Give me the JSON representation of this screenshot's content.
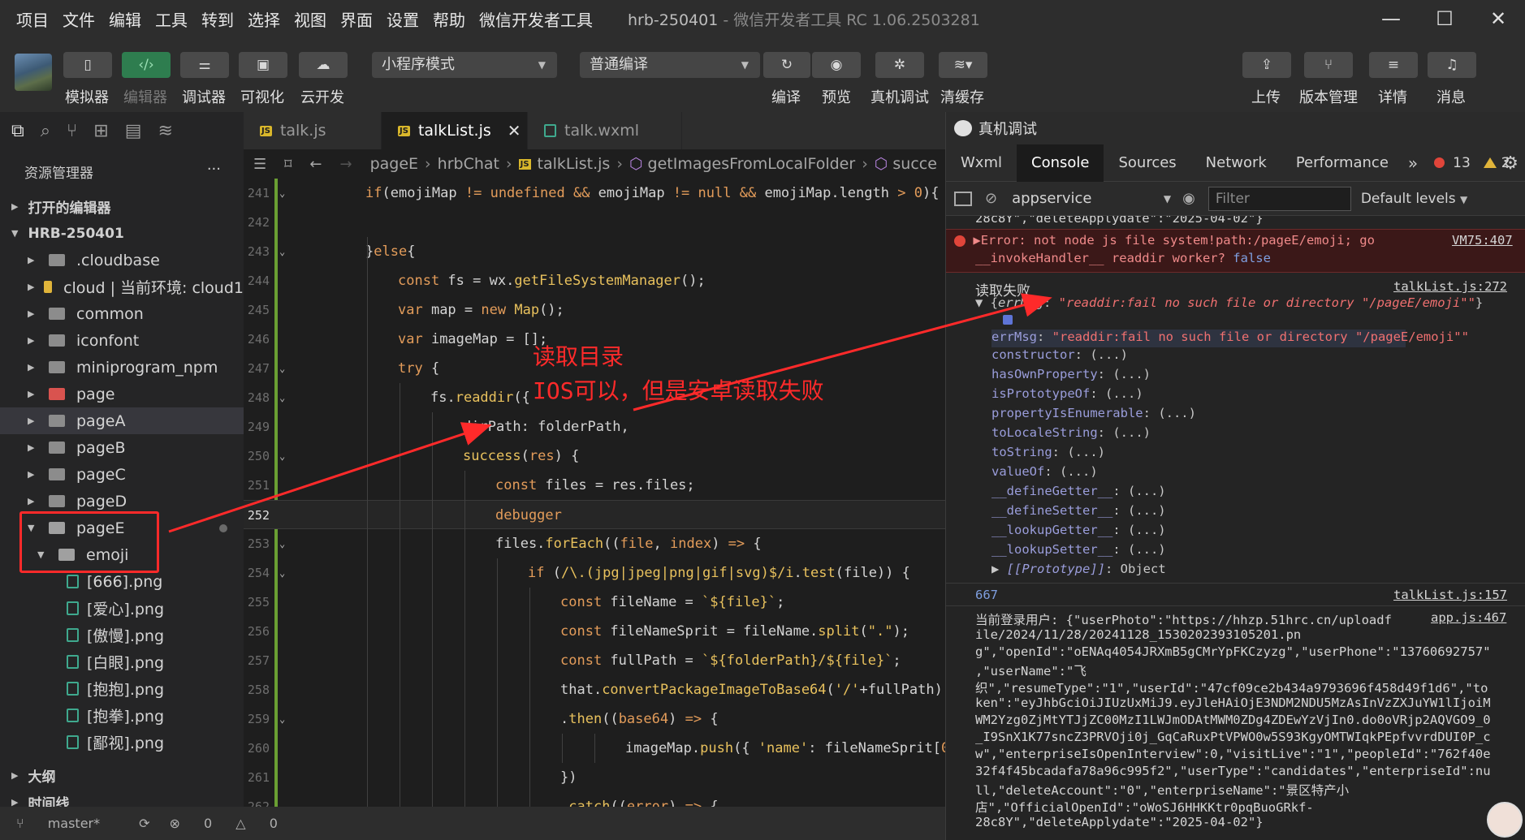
{
  "menu": [
    "项目",
    "文件",
    "编辑",
    "工具",
    "转到",
    "选择",
    "视图",
    "界面",
    "设置",
    "帮助",
    "微信开发者工具"
  ],
  "window": {
    "project": "hrb-250401",
    "title_suffix": "- 微信开发者工具 RC 1.06.2503281",
    "minimize": "—",
    "maximize": "☐",
    "close": "✕"
  },
  "toolbar": {
    "simulator": "模拟器",
    "editor": "编辑器",
    "debugger": "调试器",
    "visual": "可视化",
    "cloud": "云开发",
    "mode": "小程序模式",
    "compile": "普通编译",
    "recompile": "编译",
    "preview": "预览",
    "remote_debug": "真机调试",
    "clear_cache": "清缓存",
    "upload": "上传",
    "version": "版本管理",
    "details": "详情",
    "messages": "消息"
  },
  "explorer": {
    "title": "资源管理器",
    "more": "···",
    "open_editors": "打开的编辑器",
    "project": "HRB-250401",
    "items": [
      ".cloudbase",
      "cloud | 当前环境: cloud1",
      "common",
      "iconfont",
      "miniprogram_npm",
      "page",
      "pageA",
      "pageB",
      "pageC",
      "pageD",
      "pageE",
      "emoji"
    ],
    "files": [
      "[666].png",
      "[爱心].png",
      "[傲慢].png",
      "[白眼].png",
      "[抱抱].png",
      "[抱拳].png",
      "[鄙视].png"
    ],
    "outline": "大纲",
    "timeline": "时间线"
  },
  "status": {
    "branch": "master*",
    "errors": "0",
    "warnings": "0"
  },
  "tabs": [
    {
      "label": "talk.js"
    },
    {
      "label": "talkList.js"
    },
    {
      "label": "talk.wxml"
    }
  ],
  "breadcrumb": [
    "pageE",
    "hrbChat",
    "talkList.js",
    "getImagesFromLocalFolder",
    "succe"
  ],
  "code": {
    "lines": [
      "241",
      "242",
      "243",
      "244",
      "245",
      "246",
      "247",
      "248",
      "249",
      "250",
      "251",
      "252",
      "253",
      "254",
      "255",
      "256",
      "257",
      "258",
      "259",
      "260",
      "261",
      "262"
    ]
  },
  "annotation": {
    "line1": "读取目录",
    "line2": "IOS可以，但是安卓读取失败"
  },
  "devtools": {
    "title": "真机调试",
    "tabs": [
      "Wxml",
      "Console",
      "Sources",
      "Network",
      "Performance"
    ],
    "error_count": "13",
    "warning_count": "2",
    "context": "appservice",
    "filter_placeholder": "Filter",
    "levels": "Default levels",
    "top_partial": "28c8Y\",\"deleteApplydate\":\"2025-04-02\"}",
    "error_line1": "Error: not node js file system!path:/pageE/emoji; go",
    "error_link": "VM75:407",
    "error_line2": "__invokeHandler__ readdir worker?",
    "error_false": "false",
    "fail_label": "读取失败",
    "fail_link": "talkList.js:272",
    "errmsg_key": "errMsg",
    "errmsg_val": "\"readdir:fail no such file or directory \"/pageE/emoji\"\"",
    "props": [
      "constructor",
      "hasOwnProperty",
      "isPrototypeOf",
      "propertyIsEnumerable",
      "toLocaleString",
      "toString",
      "valueOf",
      "__defineGetter__",
      "__defineSetter__",
      "__lookupGetter__",
      "__lookupSetter__"
    ],
    "prop_value": "(...)",
    "prototype_key": "[[Prototype]]",
    "prototype_val": "Object",
    "count_val": "667",
    "count_link": "talkList.js:157",
    "user_link": "app.js:467",
    "user_lines": [
      "当前登录用户: {\"userPhoto\":\"https://hhzp.51hrc.cn/uploadf",
      "ile/2024/11/28/20241128_1530202393105201.pn",
      "g\",\"openId\":\"oENAq4054JRXmB5gCMrYpFKCzyzg\",\"userPhone\":\"13760692757\"",
      ",\"userName\":\"飞",
      "织\",\"resumeType\":\"1\",\"userId\":\"47cf09ce2b434a9793696f458d49f1d6\",\"to",
      "ken\":\"eyJhbGciOiJIUzUxMiJ9.eyJleHAiOjE3NDM2NDU5MzAsInVzZXJuYW1lIjoiM",
      "WM2Yzg0ZjMtYTJjZC00MzI1LWJmODAtMWM0ZDg4ZDEwYzVjIn0.do0oVRjp2AQVGO9_0",
      "_I9SnX1K77sncZ3PRVOji0j_GqCaRuxPtVPWO0w5S93KgyOMTWIqkPEpfvvrdDUI0P_c",
      "w\",\"enterpriseIsOpenInterview\":0,\"visitLive\":\"1\",\"peopleId\":\"762f40e",
      "32f4f45bcadafa78a96c995f2\",\"userType\":\"candidates\",\"enterpriseId\":nu",
      "ll,\"deleteAccount\":\"0\",\"enterpriseName\":\"景区特产小",
      "店\",\"OfficialOpenId\":\"oWoSJ6HHKKtr0pqBuoGRkf-",
      "28c8Y\",\"deleteApplydate\":\"2025-04-02\"}"
    ]
  },
  "colors": {
    "annotation": "#ff2a2a",
    "accent_green": "#6a9f33",
    "error_bg": "#3b1818"
  }
}
